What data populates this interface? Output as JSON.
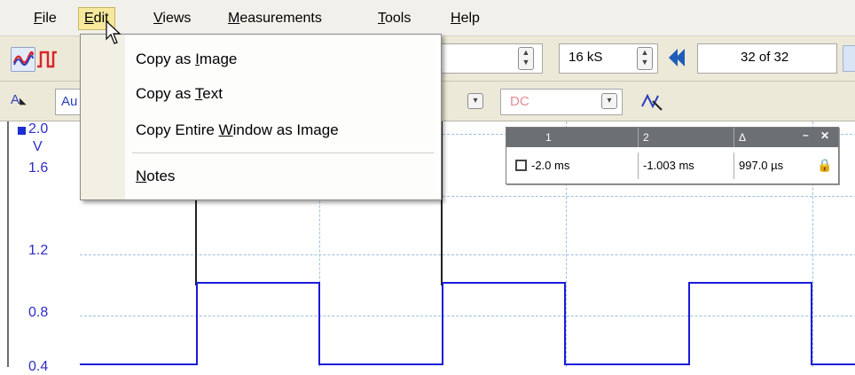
{
  "menubar": {
    "items": [
      {
        "label": "File",
        "underline_char": "F"
      },
      {
        "label": "Edit",
        "underline_char": "E"
      },
      {
        "label": "Views",
        "underline_char": "V"
      },
      {
        "label": "Measurements",
        "underline_char": "M"
      },
      {
        "label": "Tools",
        "underline_char": "T"
      },
      {
        "label": "Help",
        "underline_char": "H"
      }
    ]
  },
  "edit_menu": {
    "items": [
      {
        "before": "Copy as ",
        "key": "I",
        "after": "mage"
      },
      {
        "before": "Copy as ",
        "key": "T",
        "after": "ext"
      },
      {
        "before": "Copy Entire ",
        "key": "W",
        "after": "indow as Image"
      },
      {
        "before": "",
        "key": "N",
        "after": "otes"
      }
    ]
  },
  "toolbar": {
    "samples": "16 kS",
    "buffer": "32 of 32",
    "channel_label": "A",
    "channel_range_partial": "Au",
    "coupling": "DC"
  },
  "plot": {
    "y_labels": [
      "2.0",
      "V",
      "1.6",
      "1.2",
      "0.8",
      "0.4"
    ],
    "colors": {
      "trace": "#1b1bd8",
      "grid": "#9cc0de",
      "axis_text": "#2e2ec8"
    }
  },
  "measurements": {
    "headers": [
      "1",
      "2",
      "Δ"
    ],
    "values": [
      "-2.0 ms",
      "-1.003 ms",
      "997.0 µs"
    ]
  }
}
